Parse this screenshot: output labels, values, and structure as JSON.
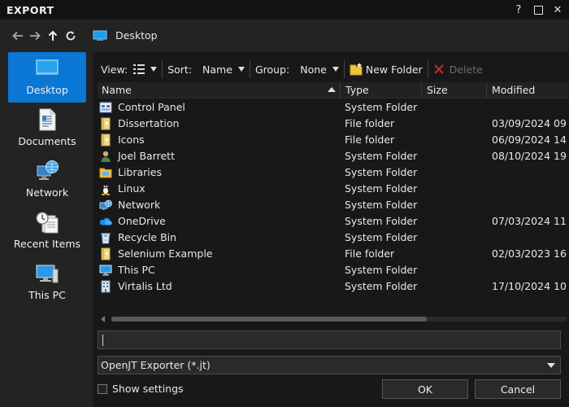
{
  "window": {
    "title": "EXPORT",
    "help": "?",
    "close": "✕"
  },
  "nav": {
    "location": "Desktop"
  },
  "sidebar": {
    "items": [
      {
        "label": "Desktop",
        "icon": "desktop-icon",
        "active": true
      },
      {
        "label": "Documents",
        "icon": "documents-icon",
        "active": false
      },
      {
        "label": "Network",
        "icon": "network-icon",
        "active": false
      },
      {
        "label": "Recent Items",
        "icon": "recent-items-icon",
        "active": false
      },
      {
        "label": "This PC",
        "icon": "this-pc-icon",
        "active": false
      }
    ]
  },
  "toolbar": {
    "view_label": "View:",
    "sort_label": "Sort:",
    "sort_value": "Name",
    "group_label": "Group:",
    "group_value": "None",
    "new_folder_label": "New Folder",
    "delete_label": "Delete"
  },
  "columns": {
    "name": "Name",
    "type": "Type",
    "size": "Size",
    "modified": "Modified"
  },
  "files": [
    {
      "name": "Control Panel",
      "type": "System Folder",
      "modified": "",
      "icon": "control-panel-icon"
    },
    {
      "name": "Dissertation",
      "type": "File folder",
      "modified": "03/09/2024 09",
      "icon": "file-folder-icon"
    },
    {
      "name": "Icons",
      "type": "File folder",
      "modified": "06/09/2024 14",
      "icon": "file-folder-icon"
    },
    {
      "name": "Joel Barrett",
      "type": "System Folder",
      "modified": "08/10/2024 19",
      "icon": "user-icon"
    },
    {
      "name": "Libraries",
      "type": "System Folder",
      "modified": "",
      "icon": "libraries-icon"
    },
    {
      "name": "Linux",
      "type": "System Folder",
      "modified": "",
      "icon": "linux-icon"
    },
    {
      "name": "Network",
      "type": "System Folder",
      "modified": "",
      "icon": "network-icon"
    },
    {
      "name": "OneDrive",
      "type": "System Folder",
      "modified": "07/03/2024 11",
      "icon": "onedrive-icon"
    },
    {
      "name": "Recycle Bin",
      "type": "System Folder",
      "modified": "",
      "icon": "recycle-bin-icon"
    },
    {
      "name": "Selenium Example",
      "type": "File folder",
      "modified": "02/03/2023 16",
      "icon": "file-folder-icon"
    },
    {
      "name": "This PC",
      "type": "System Folder",
      "modified": "",
      "icon": "this-pc-icon"
    },
    {
      "name": "Virtalis Ltd",
      "type": "System Folder",
      "modified": "17/10/2024 10",
      "icon": "building-icon"
    }
  ],
  "filename": {
    "value": ""
  },
  "filter": {
    "selected": "OpenJT Exporter (*.jt)"
  },
  "options": {
    "show_settings_label": "Show settings",
    "show_settings_checked": false
  },
  "buttons": {
    "ok": "OK",
    "cancel": "Cancel"
  },
  "colors": {
    "accent": "#0a77d4",
    "background": "#1e1e1e",
    "panel": "#181818",
    "text": "#e8e8e8"
  }
}
